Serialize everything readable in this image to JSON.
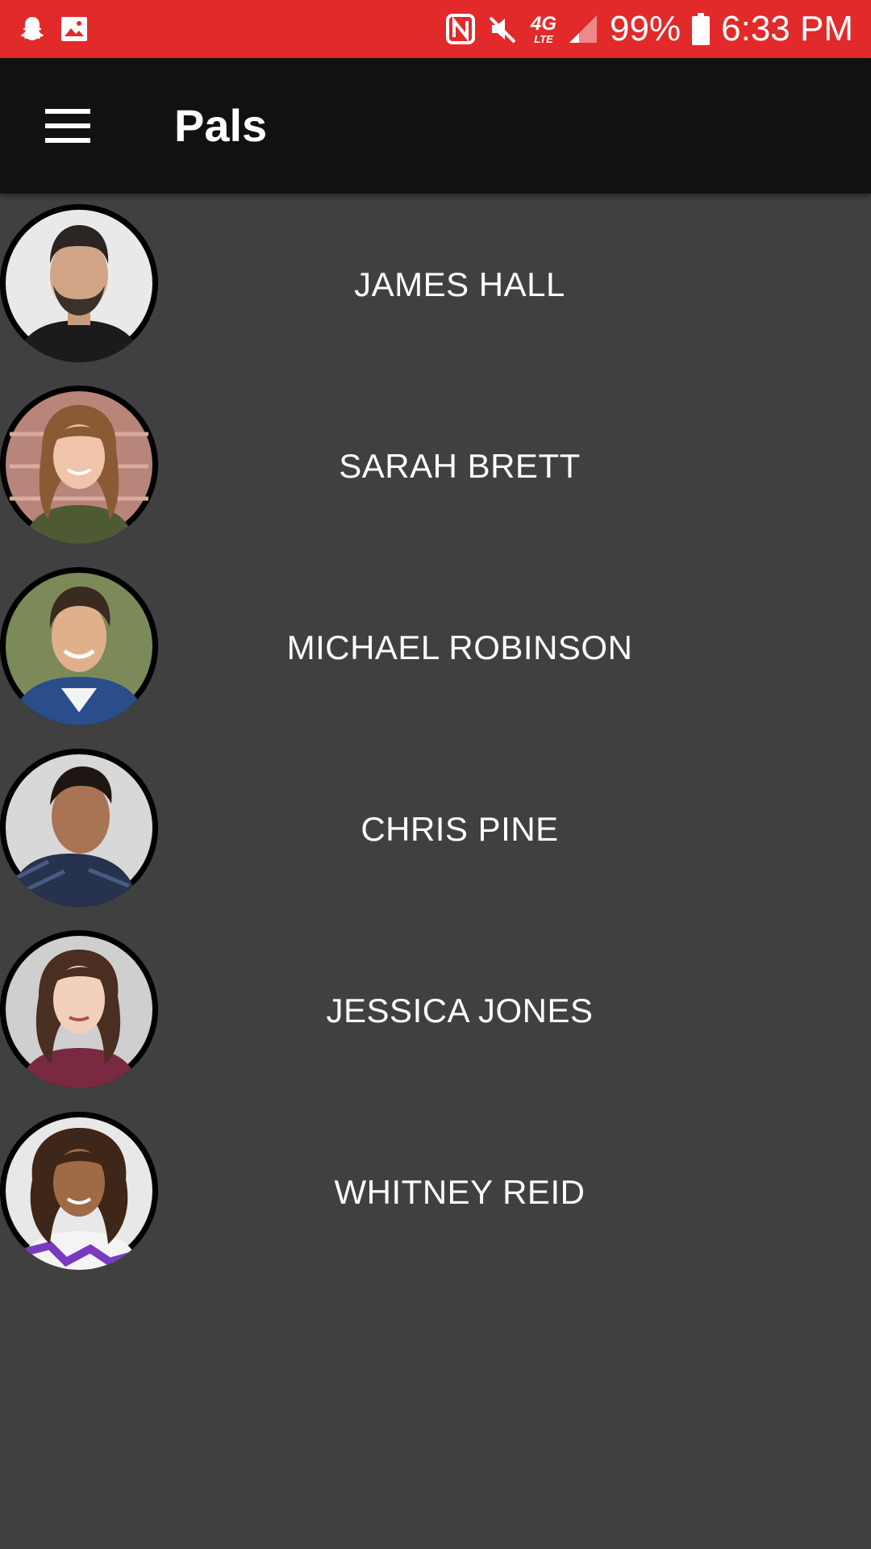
{
  "status_bar": {
    "battery": "99%",
    "time": "6:33 PM",
    "network": {
      "big": "4G",
      "small": "LTE"
    },
    "color": "#e22a2a"
  },
  "app_bar": {
    "title": "Pals",
    "background": "#111111"
  },
  "pals": [
    {
      "name": "JAMES HALL",
      "avatar": "male-beard"
    },
    {
      "name": "SARAH BRETT",
      "avatar": "female-brown-hair"
    },
    {
      "name": "MICHAEL ROBINSON",
      "avatar": "male-smiling"
    },
    {
      "name": "CHRIS PINE",
      "avatar": "male-dark-hair"
    },
    {
      "name": "JESSICA JONES",
      "avatar": "female-dark-hair"
    },
    {
      "name": "WHITNEY REID",
      "avatar": "female-curly-hair"
    }
  ]
}
